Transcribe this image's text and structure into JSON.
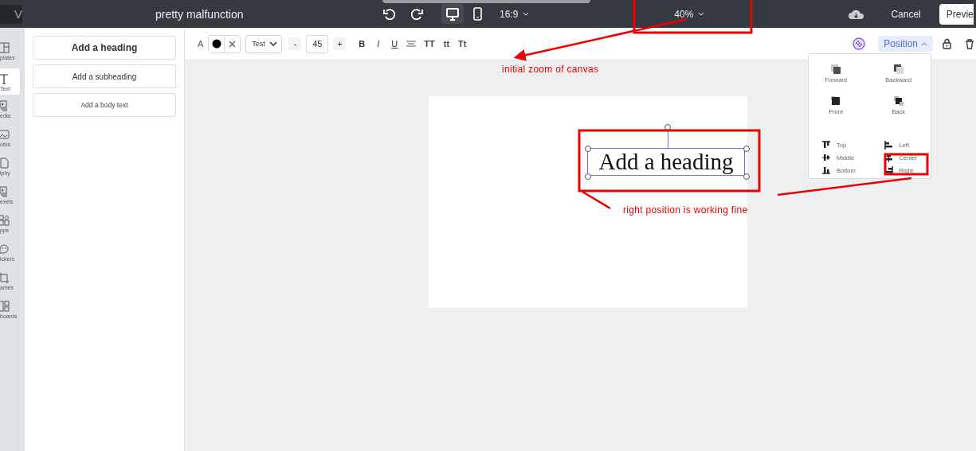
{
  "topbar": {
    "logo": "V",
    "title": "pretty malfunction",
    "devices": [
      {
        "kind": "desktop",
        "selected": true
      },
      {
        "kind": "mobile",
        "selected": false
      }
    ],
    "aspect": "16:9",
    "zoom": "40%",
    "cancel": "Cancel",
    "preview": "Previe"
  },
  "rail": [
    {
      "label": "plates",
      "kind": "templates",
      "selected": false
    },
    {
      "label": "Text",
      "kind": "text",
      "selected": true
    },
    {
      "label": "edia",
      "kind": "media",
      "selected": false
    },
    {
      "label": "otos",
      "kind": "photos",
      "selected": false
    },
    {
      "label": "iphy",
      "kind": "gif",
      "selected": false
    },
    {
      "label": "exels",
      "kind": "media",
      "selected": false
    },
    {
      "label": "pps",
      "kind": "apps",
      "selected": false
    },
    {
      "label": "ickers",
      "kind": "stickers",
      "selected": false
    },
    {
      "label": "ames",
      "kind": "frames",
      "selected": false
    },
    {
      "label": "boards",
      "kind": "boards",
      "selected": false
    }
  ],
  "panel": [
    {
      "label": "Add a heading",
      "kind": "heading"
    },
    {
      "label": "Add a subheading",
      "kind": "subheading"
    },
    {
      "label": "Add a body text",
      "kind": "body"
    }
  ],
  "toolbar": {
    "color_label": "A",
    "font": "Test",
    "minus": "-",
    "size": "45",
    "plus": "+",
    "styles": [
      "B",
      "I",
      "U"
    ],
    "cases": [
      "TT",
      "tt",
      "Tt"
    ],
    "position": "Position",
    "position_expanded": true
  },
  "position_menu": {
    "order": [
      {
        "label": "Forward",
        "kind": "forward"
      },
      {
        "label": "Backward",
        "kind": "backward"
      },
      {
        "label": "Front",
        "kind": "front"
      },
      {
        "label": "Back",
        "kind": "back"
      }
    ],
    "align": [
      {
        "label": "Top",
        "kind": "top"
      },
      {
        "label": "Left",
        "kind": "left"
      },
      {
        "label": "Middle",
        "kind": "middle"
      },
      {
        "label": "Center",
        "kind": "center"
      },
      {
        "label": "Bottom",
        "kind": "bottom"
      },
      {
        "label": "Right",
        "kind": "right"
      }
    ]
  },
  "canvas": {
    "text": "Add a heading"
  },
  "annotations": [
    {
      "text": "initial zoom of canvas"
    },
    {
      "text": "right position is working fine"
    }
  ]
}
